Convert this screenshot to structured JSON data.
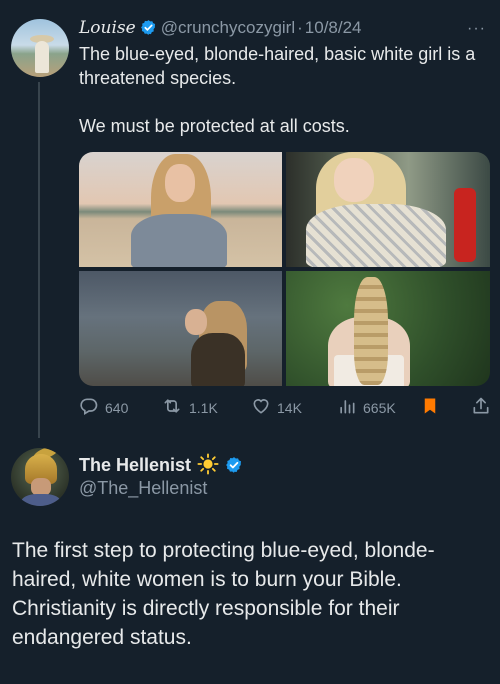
{
  "tweet": {
    "author_name": "Louise",
    "handle": "@crunchycozygirl",
    "date": "10/8/24",
    "separator": "·",
    "more": "···",
    "text_line1": "The blue-eyed, blonde-haired, basic white girl is a threatened species.",
    "text_line2": "We must be protected at all costs.",
    "stats": {
      "replies": "640",
      "reposts": "1.1K",
      "likes": "14K",
      "views": "665K"
    }
  },
  "reply": {
    "author_name": "The Hellenist",
    "handle": "@The_Hellenist",
    "text": "The first step to protecting blue-eyed, blonde-haired, white women is to burn your Bible. Christianity is directly responsible for their endangered status."
  },
  "colors": {
    "background": "#15202b",
    "text": "#e7e9ea",
    "muted": "#8b98a5",
    "verified": "#1d9bf0",
    "bookmark": "#ff7a00"
  },
  "icons": {
    "reply": "reply-icon",
    "repost": "repost-icon",
    "like": "heart-icon",
    "views": "views-icon",
    "bookmark": "bookmark-icon",
    "share": "share-icon",
    "verified": "verified-badge-icon",
    "sun": "sun-emoji-icon"
  }
}
